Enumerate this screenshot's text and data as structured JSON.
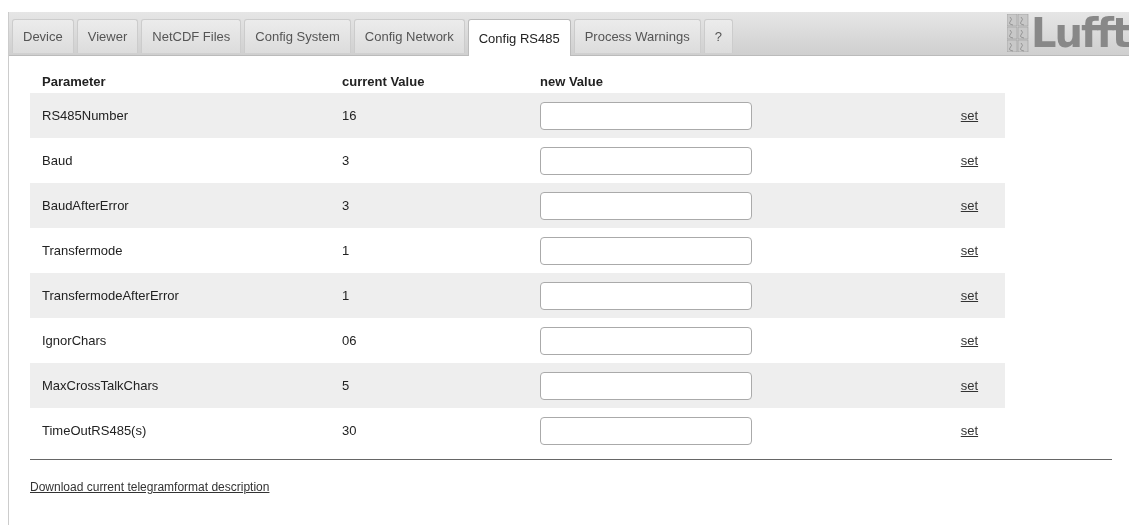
{
  "tabs": [
    {
      "label": "Device",
      "selected": false
    },
    {
      "label": "Viewer",
      "selected": false
    },
    {
      "label": "NetCDF Files",
      "selected": false
    },
    {
      "label": "Config System",
      "selected": false
    },
    {
      "label": "Config Network",
      "selected": false
    },
    {
      "label": "Config RS485",
      "selected": true
    },
    {
      "label": "Process Warnings",
      "selected": false
    },
    {
      "label": "?",
      "selected": false
    }
  ],
  "logo": {
    "text": "Lufft"
  },
  "table": {
    "columns": [
      "Parameter",
      "current Value",
      "new Value"
    ],
    "rows": [
      {
        "parameter": "RS485Number",
        "current_value": "16",
        "action": "set"
      },
      {
        "parameter": "Baud",
        "current_value": "3",
        "action": "set"
      },
      {
        "parameter": "BaudAfterError",
        "current_value": "3",
        "action": "set"
      },
      {
        "parameter": "Transfermode",
        "current_value": "1",
        "action": "set"
      },
      {
        "parameter": "TransfermodeAfterError",
        "current_value": "1",
        "action": "set"
      },
      {
        "parameter": "IgnorChars",
        "current_value": "06",
        "action": "set"
      },
      {
        "parameter": "MaxCrossTalkChars",
        "current_value": "5",
        "action": "set"
      },
      {
        "parameter": "TimeOutRS485(s)",
        "current_value": "30",
        "action": "set"
      }
    ]
  },
  "download_link": "Download current telegramformat description"
}
